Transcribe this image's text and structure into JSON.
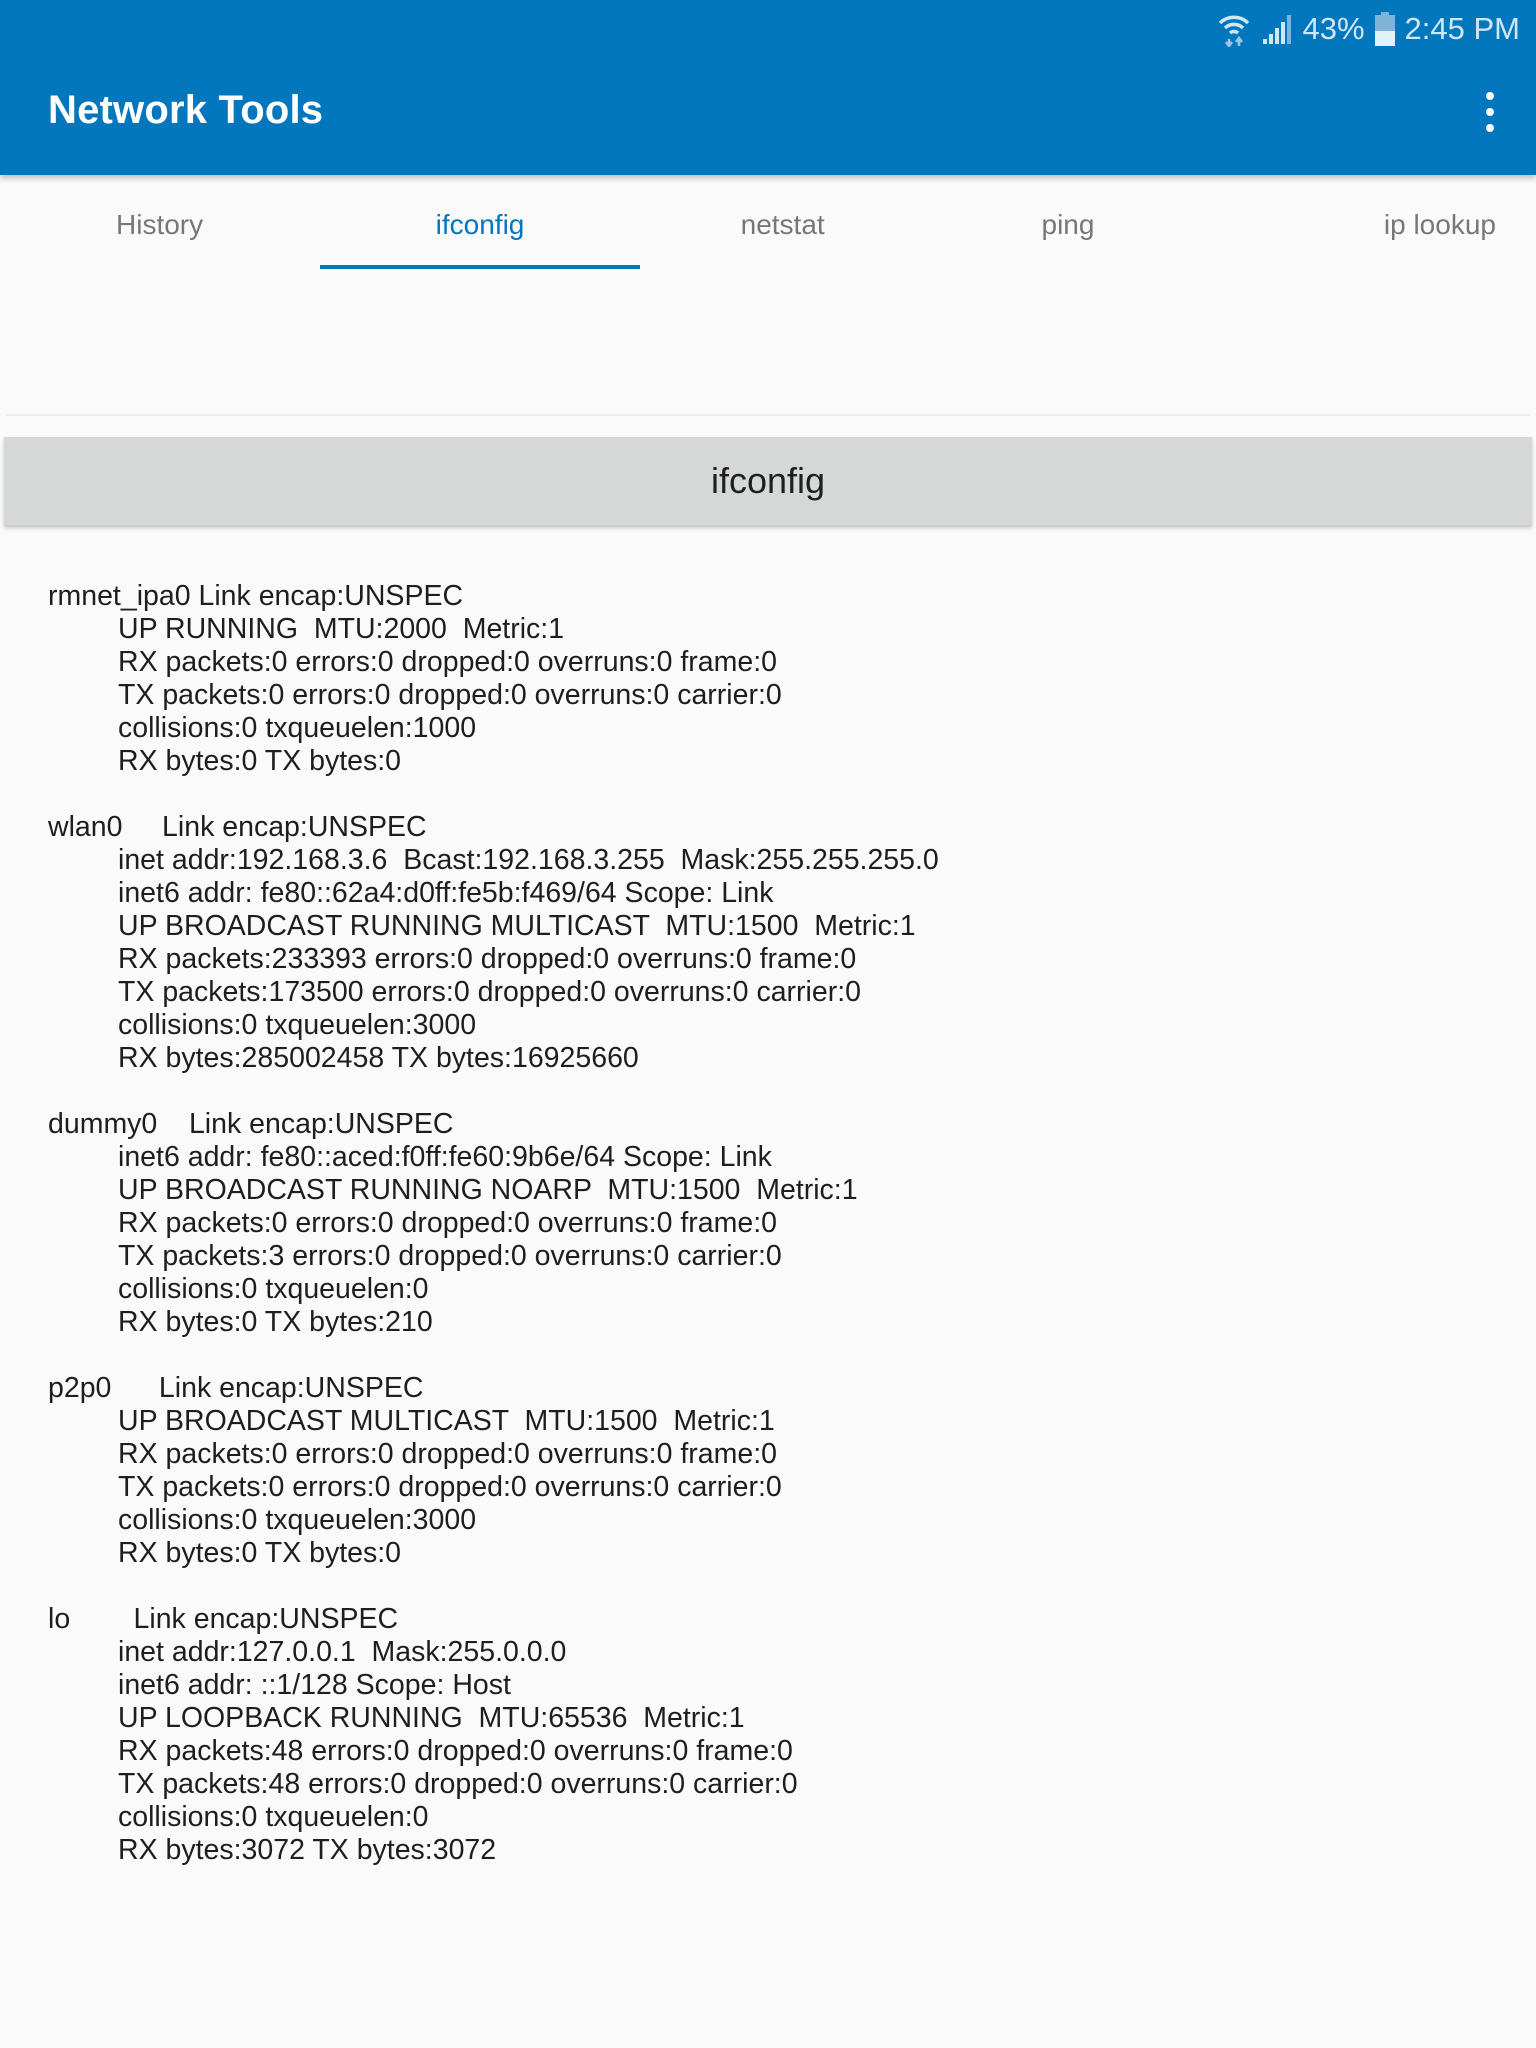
{
  "status_bar": {
    "wifi_icon": "wifi-icon",
    "signal_icon": "cellular-signal-icon",
    "battery_percent": "43%",
    "battery_level": 0.43,
    "battery_icon": "battery-icon",
    "time": "2:45 PM"
  },
  "app_bar": {
    "title": "Network Tools",
    "menu_icon": "overflow-menu-icon"
  },
  "tabs": [
    {
      "label": "History",
      "active": false
    },
    {
      "label": "ifconfig",
      "active": true
    },
    {
      "label": "netstat",
      "active": false
    },
    {
      "label": "ping",
      "active": false
    },
    {
      "label": "ip lookup",
      "active": false
    }
  ],
  "section": {
    "title": "ifconfig"
  },
  "interfaces": [
    {
      "name": "rmnet_ipa0",
      "head": "rmnet_ipa0 Link encap:UNSPEC",
      "lines": [
        "UP RUNNING  MTU:2000  Metric:1",
        "RX packets:0 errors:0 dropped:0 overruns:0 frame:0",
        "TX packets:0 errors:0 dropped:0 overruns:0 carrier:0",
        "collisions:0 txqueuelen:1000",
        "RX bytes:0 TX bytes:0"
      ]
    },
    {
      "name": "wlan0",
      "head": "wlan0     Link encap:UNSPEC",
      "lines": [
        "inet addr:192.168.3.6  Bcast:192.168.3.255  Mask:255.255.255.0",
        "inet6 addr: fe80::62a4:d0ff:fe5b:f469/64 Scope: Link",
        "UP BROADCAST RUNNING MULTICAST  MTU:1500  Metric:1",
        "RX packets:233393 errors:0 dropped:0 overruns:0 frame:0",
        "TX packets:173500 errors:0 dropped:0 overruns:0 carrier:0",
        "collisions:0 txqueuelen:3000",
        "RX bytes:285002458 TX bytes:16925660"
      ]
    },
    {
      "name": "dummy0",
      "head": "dummy0    Link encap:UNSPEC",
      "lines": [
        "inet6 addr: fe80::aced:f0ff:fe60:9b6e/64 Scope: Link",
        "UP BROADCAST RUNNING NOARP  MTU:1500  Metric:1",
        "RX packets:0 errors:0 dropped:0 overruns:0 frame:0",
        "TX packets:3 errors:0 dropped:0 overruns:0 carrier:0",
        "collisions:0 txqueuelen:0",
        "RX bytes:0 TX bytes:210"
      ]
    },
    {
      "name": "p2p0",
      "head": "p2p0      Link encap:UNSPEC",
      "lines": [
        "UP BROADCAST MULTICAST  MTU:1500  Metric:1",
        "RX packets:0 errors:0 dropped:0 overruns:0 frame:0",
        "TX packets:0 errors:0 dropped:0 overruns:0 carrier:0",
        "collisions:0 txqueuelen:3000",
        "RX bytes:0 TX bytes:0"
      ]
    },
    {
      "name": "lo",
      "head": "lo        Link encap:UNSPEC",
      "lines": [
        "inet addr:127.0.0.1  Mask:255.0.0.0",
        "inet6 addr: ::1/128 Scope: Host",
        "UP LOOPBACK RUNNING  MTU:65536  Metric:1",
        "RX packets:48 errors:0 dropped:0 overruns:0 frame:0",
        "TX packets:48 errors:0 dropped:0 overruns:0 carrier:0",
        "collisions:0 txqueuelen:0",
        "RX bytes:3072 TX bytes:3072"
      ]
    }
  ],
  "colors": {
    "primary": "#0277bd",
    "tab_inactive": "#777777",
    "section_header_bg": "#d6d7d7",
    "background": "#fafafa"
  }
}
